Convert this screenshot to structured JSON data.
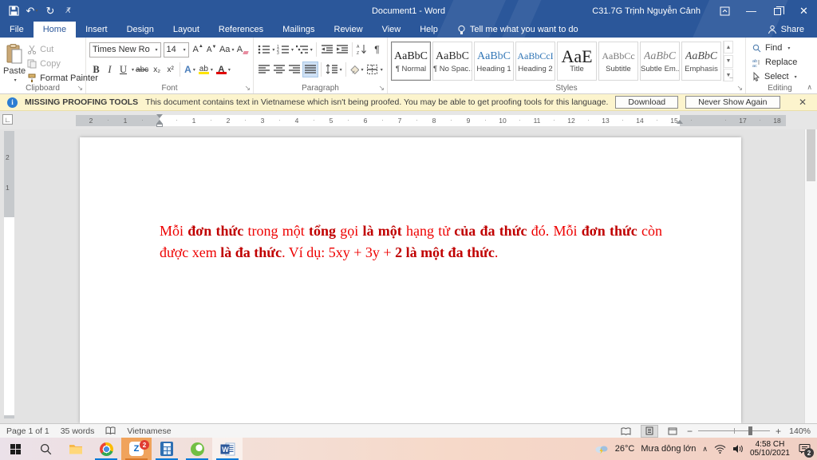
{
  "colors": {
    "titlebar_blue": "#2b579a",
    "heading_blue": "#2e74b5",
    "text_red": "#ee0000",
    "text_red_bold": "#c00000",
    "taskbar_underline": "#0078d7",
    "warning_bg": "#fcf4cd"
  },
  "titlebar": {
    "title": "Document1  -  Word",
    "user": "C31.7G Trịnh Nguyễn Cảnh"
  },
  "tabs": [
    {
      "label": "File",
      "active": false
    },
    {
      "label": "Home",
      "active": true
    },
    {
      "label": "Insert",
      "active": false
    },
    {
      "label": "Design",
      "active": false
    },
    {
      "label": "Layout",
      "active": false
    },
    {
      "label": "References",
      "active": false
    },
    {
      "label": "Mailings",
      "active": false
    },
    {
      "label": "Review",
      "active": false
    },
    {
      "label": "View",
      "active": false
    },
    {
      "label": "Help",
      "active": false
    }
  ],
  "tellme": "Tell me what you want to do",
  "share": "Share",
  "ribbon": {
    "clipboard": {
      "label": "Clipboard",
      "paste": "Paste",
      "cut": "Cut",
      "copy": "Copy",
      "format_painter": "Format Painter"
    },
    "font": {
      "label": "Font",
      "name": "Times New Ro",
      "size": "14",
      "bold": "B",
      "italic": "I",
      "underline": "U",
      "strike": "abc",
      "subscript": "x₂",
      "superscript": "x²",
      "change_case": "Aa",
      "grow": "A",
      "shrink": "A",
      "effects": "A",
      "highlight": "ab",
      "font_color": "A"
    },
    "paragraph": {
      "label": "Paragraph",
      "pilcrow": "¶"
    },
    "styles": {
      "label": "Styles",
      "items": [
        {
          "preview": "AaBbC",
          "label": "¶ Normal",
          "cls": "normal",
          "selected": true
        },
        {
          "preview": "AaBbC",
          "label": "¶ No Spac...",
          "cls": "normal",
          "selected": false
        },
        {
          "preview": "AaBbC",
          "label": "Heading 1",
          "cls": "h1",
          "selected": false
        },
        {
          "preview": "AaBbCcI",
          "label": "Heading 2",
          "cls": "h2",
          "selected": false
        },
        {
          "preview": "AaE",
          "label": "Title",
          "cls": "title",
          "selected": false
        },
        {
          "preview": "AaBbCc",
          "label": "Subtitle",
          "cls": "subtitle",
          "selected": false
        },
        {
          "preview": "AaBbC",
          "label": "Subtle Em...",
          "cls": "subtle",
          "selected": false
        },
        {
          "preview": "AaBbC",
          "label": "Emphasis",
          "cls": "emphasis",
          "selected": false
        }
      ]
    },
    "editing": {
      "label": "Editing",
      "find": "Find",
      "replace": "Replace",
      "select": "Select"
    }
  },
  "proofing_bar": {
    "title": "MISSING PROOFING TOOLS",
    "message": "This document contains text in Vietnamese which isn't being proofed. You may be able to get proofing tools for this language.",
    "download": "Download",
    "never_show": "Never Show Again"
  },
  "ruler": {
    "left_numbers": [
      "2",
      "1"
    ],
    "numbers": [
      "1",
      "2",
      "3",
      "4",
      "5",
      "6",
      "7",
      "8",
      "9",
      "10",
      "11",
      "12",
      "13",
      "14",
      "15"
    ],
    "right_numbers": [
      "17",
      "18"
    ],
    "vertical_numbers": [
      "2",
      "1"
    ]
  },
  "document": {
    "runs": [
      {
        "text": "Mỗi ",
        "bold": false
      },
      {
        "text": "đơn thức",
        "bold": true
      },
      {
        "text": " trong  một ",
        "bold": false
      },
      {
        "text": "tổng",
        "bold": true
      },
      {
        "text": " gọi ",
        "bold": false
      },
      {
        "text": "là một",
        "bold": true
      },
      {
        "text": " hạng tử ",
        "bold": false
      },
      {
        "text": "của đa thức",
        "bold": true
      },
      {
        "text": " đó. Mỗi ",
        "bold": false
      },
      {
        "text": "đơn thức",
        "bold": true
      },
      {
        "text": " còn được xem ",
        "bold": false
      },
      {
        "text": "là đa thức",
        "bold": true
      },
      {
        "text": ". Ví dụ: 5xy + 3y + ",
        "bold": false
      },
      {
        "text": "2 là một đa thức",
        "bold": true
      },
      {
        "text": ".",
        "bold": false
      }
    ]
  },
  "status": {
    "page": "Page 1 of 1",
    "words": "35 words",
    "language": "Vietnamese",
    "zoom": "140%"
  },
  "taskbar": {
    "temp": "26°C",
    "weather": "Mưa dông lớn",
    "time": "4:58 CH",
    "date": "05/10/2021",
    "zalo_badge": "2",
    "notif_badge": "2"
  }
}
